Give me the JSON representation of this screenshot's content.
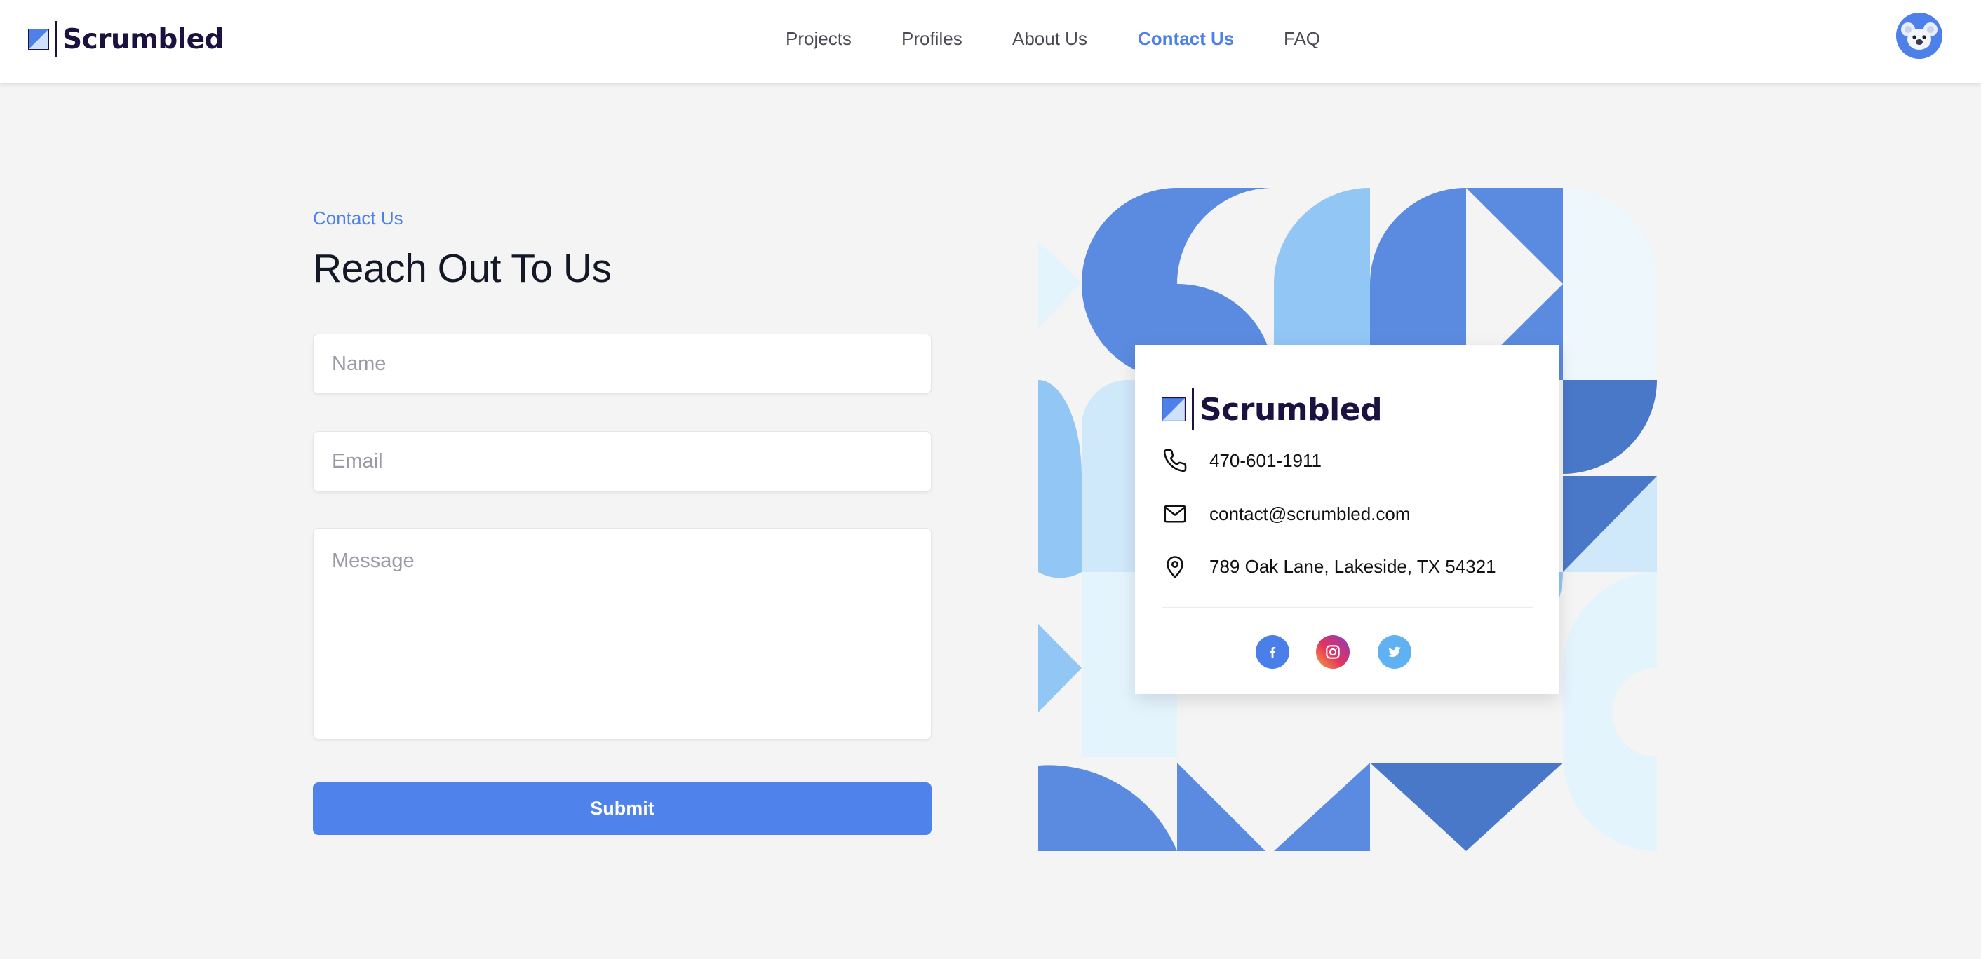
{
  "header": {
    "brand": "Scrumbled",
    "nav": [
      {
        "label": "Projects",
        "active": false
      },
      {
        "label": "Profiles",
        "active": false
      },
      {
        "label": "About Us",
        "active": false
      },
      {
        "label": "Contact Us",
        "active": true
      },
      {
        "label": "FAQ",
        "active": false
      }
    ]
  },
  "form": {
    "eyebrow": "Contact Us",
    "title": "Reach Out To Us",
    "name_placeholder": "Name",
    "email_placeholder": "Email",
    "message_placeholder": "Message",
    "submit_label": "Submit"
  },
  "card": {
    "brand": "Scrumbled",
    "phone": "470-601-1911",
    "email": "contact@scrumbled.com",
    "address": "789 Oak Lane, Lakeside, TX 54321",
    "icons": [
      "phone-icon",
      "mail-icon",
      "location-pin-icon"
    ],
    "social": [
      "facebook-icon",
      "instagram-icon",
      "twitter-icon"
    ]
  },
  "colors": {
    "accent": "#4d80e8",
    "brand_text": "#1c1240",
    "pattern": [
      "#5b8be0",
      "#4a78c8",
      "#92c6f5",
      "#cfe8fa",
      "#e4f4fd",
      "#eef8fc"
    ]
  }
}
